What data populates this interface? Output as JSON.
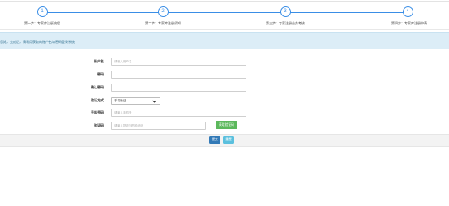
{
  "steps": [
    {
      "number": "1",
      "label": "第一步：专家库注册流程"
    },
    {
      "number": "2",
      "label": "第二步：专家库注册须知"
    },
    {
      "number": "3",
      "label": "第三步：专家注册业务考核"
    },
    {
      "number": "4",
      "label": "第四步：专家库注册申请"
    }
  ],
  "notice": "您好，完成后，请利用获取的账户名和密码登录系统",
  "form": {
    "username": {
      "label": "账户名",
      "placeholder": "请输入用户名",
      "value": ""
    },
    "password": {
      "label": "密码",
      "placeholder": "",
      "value": ""
    },
    "confirm_password": {
      "label": "确认密码",
      "placeholder": "",
      "value": ""
    },
    "verify_method": {
      "label": "验证方式",
      "selected": "手机验证"
    },
    "phone": {
      "label": "手机号码",
      "placeholder": "请输入手机号",
      "value": ""
    },
    "code": {
      "label": "验证码",
      "placeholder": "请输入您收到的验证码",
      "value": "",
      "button": "获取验证码"
    }
  },
  "actions": {
    "submit": "提交",
    "reset": "重置"
  },
  "colors": {
    "accent": "#3a8ee6",
    "banner": "#dcedf7",
    "code_button": "#5cb85c",
    "submit_button": "#337ab7",
    "reset_button": "#5bc0de"
  }
}
